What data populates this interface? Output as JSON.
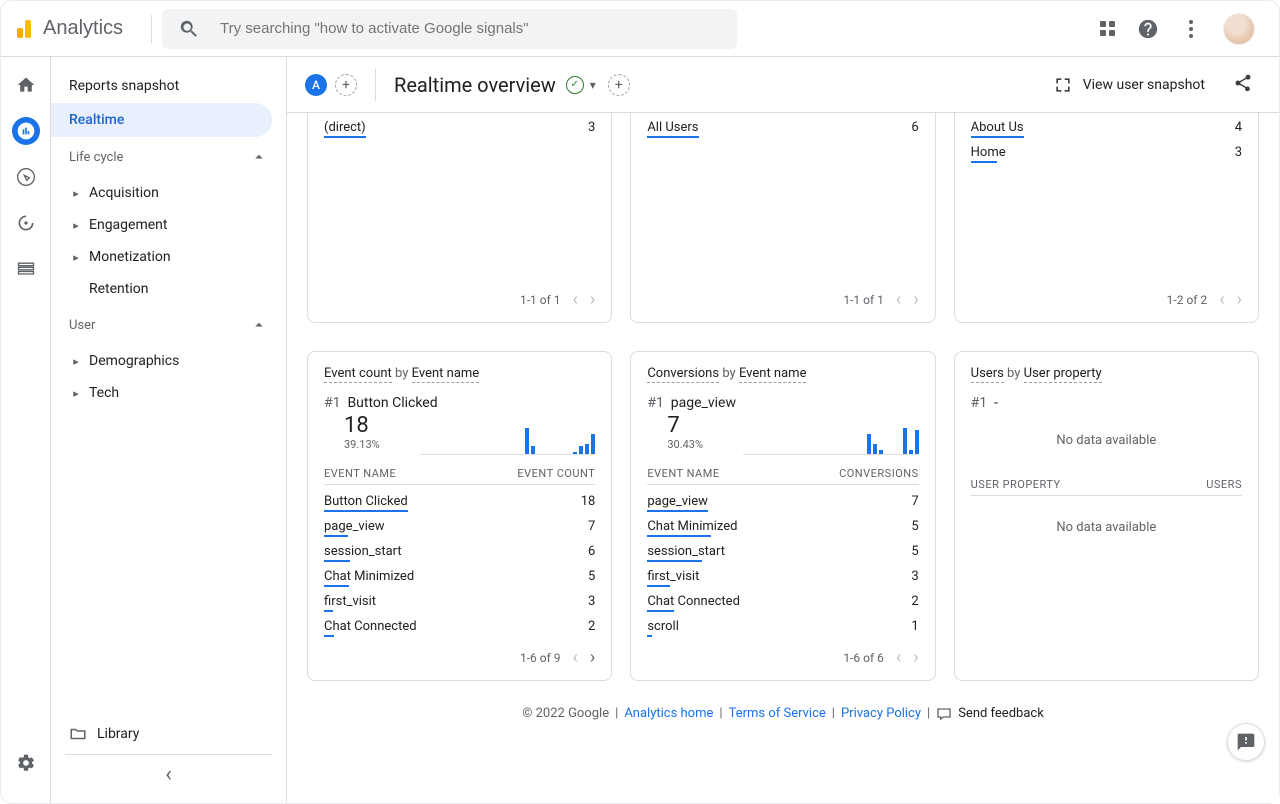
{
  "header": {
    "app_name": "Analytics",
    "search_placeholder": "Try searching \"how to activate Google signals\""
  },
  "sidebar": {
    "reports_snapshot": "Reports snapshot",
    "realtime": "Realtime",
    "section_lifecycle": "Life cycle",
    "lifecycle_items": [
      "Acquisition",
      "Engagement",
      "Monetization",
      "Retention"
    ],
    "section_user": "User",
    "user_items": [
      "Demographics",
      "Tech"
    ],
    "library": "Library"
  },
  "titlebar": {
    "badge_letter": "A",
    "page_title": "Realtime overview",
    "snapshot_button": "View user snapshot"
  },
  "cards_top": [
    {
      "rows": [
        {
          "label": "(direct)",
          "value": "3",
          "bar_pct": 100
        }
      ],
      "pager": "1-1 of 1"
    },
    {
      "rows": [
        {
          "label": "All Users",
          "value": "6",
          "bar_pct": 100
        }
      ],
      "pager": "1-1 of 1"
    },
    {
      "rows": [
        {
          "label": "About Us",
          "value": "4",
          "bar_pct": 100
        },
        {
          "label": "Home",
          "value": "3",
          "bar_pct": 75
        }
      ],
      "pager": "1-2 of 2"
    }
  ],
  "cards_bottom": [
    {
      "title_a": "Event count",
      "title_b": "by",
      "title_c": "Event name",
      "rank": "#1",
      "rank_label": "Button Clicked",
      "big": "18",
      "pct": "39.13%",
      "spark": [
        0,
        0,
        0,
        0,
        0,
        0,
        0,
        0,
        0,
        26,
        8,
        0,
        0,
        0,
        0,
        0,
        0,
        2,
        8,
        10,
        20
      ],
      "col_a": "Event name",
      "col_b": "Event count",
      "rows": [
        {
          "label": "Button Clicked",
          "value": "18",
          "bar_pct": 100
        },
        {
          "label": "page_view",
          "value": "7",
          "bar_pct": 39
        },
        {
          "label": "session_start",
          "value": "6",
          "bar_pct": 33
        },
        {
          "label": "Chat Minimized",
          "value": "5",
          "bar_pct": 28
        },
        {
          "label": "first_visit",
          "value": "3",
          "bar_pct": 17
        },
        {
          "label": "Chat Connected",
          "value": "2",
          "bar_pct": 11
        }
      ],
      "pager": "1-6 of 9",
      "next": true
    },
    {
      "title_a": "Conversions",
      "title_b": "by",
      "title_c": "Event name",
      "rank": "#1",
      "rank_label": "page_view",
      "big": "7",
      "pct": "30.43%",
      "spark": [
        0,
        0,
        0,
        0,
        0,
        0,
        0,
        0,
        0,
        0,
        0,
        0,
        20,
        10,
        4,
        0,
        0,
        0,
        26,
        4,
        24
      ],
      "col_a": "Event name",
      "col_b": "Conversions",
      "rows": [
        {
          "label": "page_view",
          "value": "7",
          "bar_pct": 100
        },
        {
          "label": "Chat Minimized",
          "value": "5",
          "bar_pct": 71
        },
        {
          "label": "session_start",
          "value": "5",
          "bar_pct": 71
        },
        {
          "label": "first_visit",
          "value": "3",
          "bar_pct": 43
        },
        {
          "label": "Chat Connected",
          "value": "2",
          "bar_pct": 29
        },
        {
          "label": "scroll",
          "value": "1",
          "bar_pct": 14
        }
      ],
      "pager": "1-6 of 6",
      "next": false
    },
    {
      "title_a": "Users",
      "title_b": "by",
      "title_c": "User property",
      "rank": "#1",
      "rank_label": "-",
      "big": "",
      "pct": "",
      "nodata": "No data available",
      "col_a": "User property",
      "col_b": "Users",
      "rows": [],
      "table_empty": "No data available"
    }
  ],
  "footer": {
    "copyright": "© 2022 Google",
    "sep": " | ",
    "links": [
      "Analytics home",
      "Terms of Service",
      "Privacy Policy"
    ],
    "feedback": "Send feedback"
  }
}
